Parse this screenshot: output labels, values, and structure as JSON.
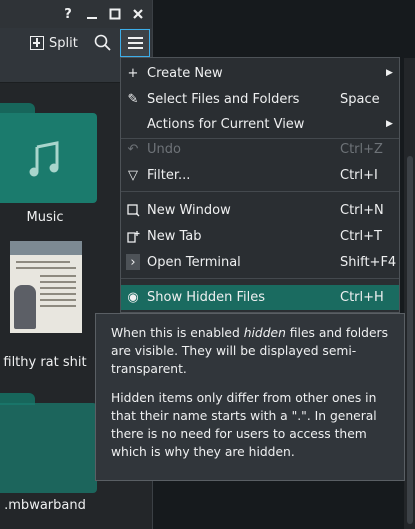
{
  "titlebar": {
    "help_icon": "?",
    "minimize_icon": "minimize",
    "maximize_icon": "maximize",
    "close_icon": "close"
  },
  "toolbar": {
    "split_label": "Split",
    "search_icon": "search",
    "menu_icon": "hamburger"
  },
  "view": {
    "items": [
      {
        "label": "Music"
      },
      {
        "label": "filthy rat shit"
      },
      {
        "label": ".mbwarband"
      }
    ]
  },
  "menu": {
    "items": [
      {
        "icon": "+",
        "label": "Create New",
        "shortcut": "",
        "submenu": true
      },
      {
        "icon": "✎",
        "label": "Select Files and Folders",
        "shortcut": "Space",
        "submenu": false
      },
      {
        "icon": "",
        "label": "Actions for Current View",
        "shortcut": "",
        "submenu": true
      },
      {
        "icon": "↶",
        "label": "Undo",
        "shortcut": "Ctrl+Z",
        "disabled": true
      },
      {
        "icon": "▽",
        "label": "Filter...",
        "shortcut": "Ctrl+I"
      },
      {
        "icon": "",
        "label": "New Window",
        "shortcut": "Ctrl+N"
      },
      {
        "icon": "",
        "label": "New Tab",
        "shortcut": "Ctrl+T"
      },
      {
        "icon": "›",
        "label": "Open Terminal",
        "shortcut": "Shift+F4"
      },
      {
        "icon": "◉",
        "label": "Show Hidden Files",
        "shortcut": "Ctrl+H",
        "highlighted": true
      }
    ]
  },
  "tooltip": {
    "p1_a": "When this is enabled ",
    "p1_em": "hidden",
    "p1_b": " files and folders are visible. They will be displayed semi-transparent.",
    "p2": "Hidden items only differ from other ones in that their name starts with a \".\". In general there is no need for users to access them which is why they are hidden."
  },
  "colors": {
    "accent": "#3daee9",
    "highlight": "#1a6b60",
    "folder": "#1b7b6d"
  }
}
